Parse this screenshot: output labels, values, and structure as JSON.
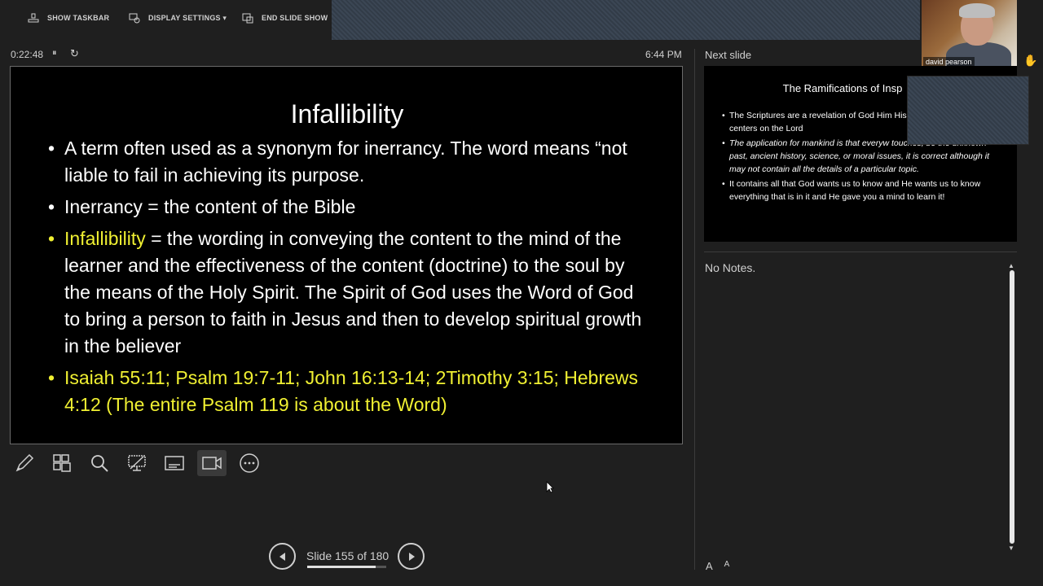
{
  "toolbar": {
    "show_taskbar": "SHOW TASKBAR",
    "display_settings": "DISPLAY SETTINGS ▾",
    "end_slide_show": "END SLIDE SHOW"
  },
  "webcam": {
    "participant_name": "david pearson"
  },
  "status": {
    "elapsed": "0:22:48",
    "pause_icon": "⏸",
    "reset_icon": "↻",
    "clock": "6:44 PM"
  },
  "current_slide": {
    "title": "Infallibility",
    "bullet1": "A term often used as a synonym for inerrancy. The word means “not liable to fail in achieving its purpose.",
    "bullet2": "Inerrancy = the content of the Bible",
    "bullet3_highlight": "Infallibility",
    "bullet3_rest": " = the wording in conveying the content to the mind of the learner and the effectiveness of the content (doctrine) to the soul by the means of the Holy Spirit. The Spirit of God uses the Word of God to bring a person to faith in Jesus and then to develop spiritual growth in the believer",
    "bullet4": "Isaiah 55:11; Psalm 19:7-11; John 16:13-14; 2Timothy 3:15; Hebrews 4:12 (The entire Psalm 119 is about the Word)"
  },
  "tools": [
    "pen-icon",
    "slides-grid-icon",
    "zoom-icon",
    "pointer-screen-icon",
    "subtitles-icon",
    "camera-icon",
    "more-icon"
  ],
  "navigation": {
    "counter": "Slide 155 of 180",
    "current": 155,
    "total": 180,
    "progress_fraction": 0.861
  },
  "next_slide": {
    "label": "Next slide",
    "title": "The Ramifications of Insp",
    "bullet1": "The Scriptures are a revelation of God Him His creation. This plan centers on the Lord",
    "bullet2": "The application for mankind is that everyw touches, be the unknown past, ancient history, science, or moral issues, it is correct although it may not contain all the details of a particular topic.",
    "bullet3": "It contains all that God wants us to know and He wants us to know everything that is in it and He gave you a mind to learn it!"
  },
  "notes": {
    "text": "No Notes."
  },
  "font_controls": {
    "increase": "A",
    "decrease": "A"
  },
  "colors": {
    "background": "#1f1f1f",
    "slide_background": "#000000",
    "highlight_yellow": "#f0f032"
  }
}
